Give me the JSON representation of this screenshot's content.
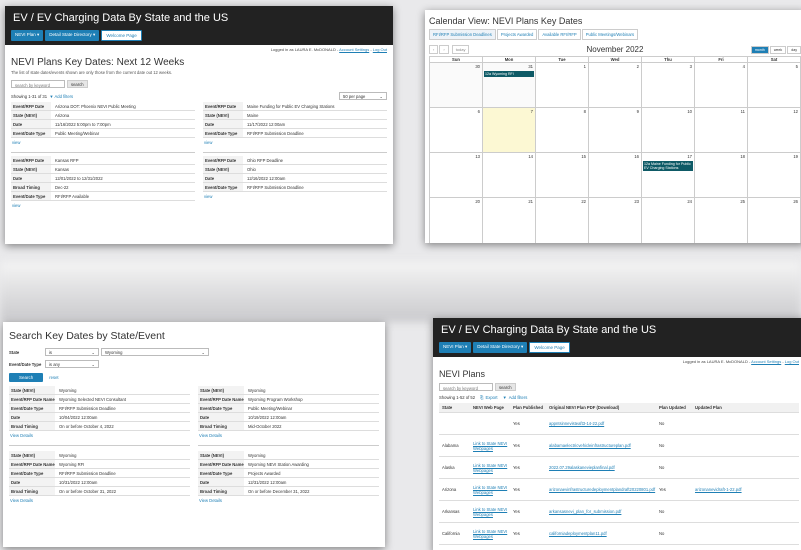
{
  "p1": {
    "app_title": "EV / EV Charging Data By State and the US",
    "nav": [
      "NEVI Plan ▾",
      "Detail State Directory ▾",
      "Welcome Page"
    ],
    "login_prefix": "Logged in as LAURA E. McDONALD - ",
    "account_settings": "Account Settings",
    "login_sep": " - ",
    "logout": "Log Out",
    "title": "NEVI Plans Key Dates: Next 12 Weeks",
    "subtitle": "The list of state dates/events shown are only those from the current date out 12 weeks.",
    "search_placeholder": "search by keyword",
    "search_btn": "search",
    "showing": "Showing 1-31 of 31",
    "add_filters": "Add filters",
    "per_page": "50 per page",
    "view_label": "view",
    "records": [
      {
        "fields": [
          [
            "Event/RFP Date",
            "Arizona DOT: Phoenix NEVI Public Meeting"
          ],
          [
            "State (NEVI)",
            "Arizona"
          ],
          [
            "Date",
            "11/16/2022 5:00pm to 7:00pm"
          ],
          [
            "Event/Date Type",
            "Public Meeting/Webinar"
          ]
        ]
      },
      {
        "fields": [
          [
            "Event/RFP Date",
            "Maine Funding for Public EV Charging Stations"
          ],
          [
            "State (NEVI)",
            "Maine"
          ],
          [
            "Date",
            "11/17/2022 12:00am"
          ],
          [
            "Event/Date Type",
            "RFI/RFP Submission Deadline"
          ]
        ]
      },
      {
        "fields": [
          [
            "Event/RFP Date",
            "Kansas RFP"
          ],
          [
            "State (NEVI)",
            "Kansas"
          ],
          [
            "Date",
            "12/01/2022 to 12/31/2022"
          ],
          [
            "Broad Timing",
            "Dec-22"
          ],
          [
            "Event/Date Type",
            "RFI/RFP Available"
          ]
        ]
      },
      {
        "fields": [
          [
            "Event/RFP Date",
            "Ohio RFP Deadline"
          ],
          [
            "State (NEVI)",
            "Ohio"
          ],
          [
            "Date",
            "12/16/2022 12:00am"
          ],
          [
            "Event/Date Type",
            "RFI/RFP Submission Deadline"
          ]
        ]
      }
    ]
  },
  "p2": {
    "title": "Calendar View: NEVI Plans Key Dates",
    "tabs": [
      "RFI/RFP Submission Deadlines",
      "Projects Awarded",
      "Available RFI/RFP",
      "Public Meetings/Webinars"
    ],
    "nav_prev": "‹",
    "nav_next": "›",
    "today": "today",
    "month": "November 2022",
    "views": [
      "month",
      "week",
      "day"
    ],
    "days": [
      "Sun",
      "Mon",
      "Tue",
      "Wed",
      "Thu",
      "Fri",
      "Sat"
    ],
    "weeks": [
      [
        "30",
        "31",
        "1",
        "2",
        "3",
        "4",
        "5"
      ],
      [
        "6",
        "7",
        "8",
        "9",
        "10",
        "11",
        "12"
      ],
      [
        "13",
        "14",
        "15",
        "16",
        "17",
        "18",
        "19"
      ],
      [
        "20",
        "21",
        "22",
        "23",
        "24",
        "25",
        "26"
      ]
    ],
    "event1": "12a Wyoming RFI",
    "event2": "12a Maine Funding for Public EV Charging Stations"
  },
  "p3": {
    "title": "Search Key Dates by State/Event",
    "state_label": "State",
    "op": "is",
    "state_value": "Wyoming",
    "type_label": "Event/Date Type",
    "type_value": "is any",
    "search_btn": "Search",
    "reset": "reset",
    "view_details": "View Details",
    "records": [
      {
        "fields": [
          [
            "State (NEVI)",
            "Wyoming"
          ],
          [
            "Event/RFP Date Name",
            "Wyoming Selected NEVI Consultant"
          ],
          [
            "Event/Date Type",
            "RFI/RFP Submission Deadline"
          ],
          [
            "Date",
            "10/04/2022 12:00am"
          ],
          [
            "Broad Timing",
            "On or before October 4, 2022"
          ]
        ]
      },
      {
        "fields": [
          [
            "State (NEVI)",
            "Wyoming"
          ],
          [
            "Event/RFP Date Name",
            "Wyoming Program Workshop"
          ],
          [
            "Event/Date Type",
            "Public Meeting/Webinar"
          ],
          [
            "Date",
            "10/19/2022 12:00am"
          ],
          [
            "Broad Timing",
            "Mid-October 2022"
          ]
        ]
      },
      {
        "fields": [
          [
            "State (NEVI)",
            "Wyoming"
          ],
          [
            "Event/RFP Date Name",
            "Wyoming RFI"
          ],
          [
            "Event/Date Type",
            "RFI/RFP Submission Deadline"
          ],
          [
            "Date",
            "10/31/2022 12:00am"
          ],
          [
            "Broad Timing",
            "On or before October 31, 2022"
          ]
        ]
      },
      {
        "fields": [
          [
            "State (NEVI)",
            "Wyoming"
          ],
          [
            "Event/RFP Date Name",
            "Wyoming NEVI Station Awarding"
          ],
          [
            "Event/Date Type",
            "Projects Awarded"
          ],
          [
            "Date",
            "12/31/2022 12:00am"
          ],
          [
            "Broad Timing",
            "On or before December 31, 2022"
          ]
        ]
      }
    ]
  },
  "p4": {
    "app_title": "EV / EV Charging Data By State and the US",
    "nav": [
      "NEVI Plan ▾",
      "Detail State Directory ▾",
      "Welcome Page"
    ],
    "login_prefix": "Logged in as LAURA E. McDONALD - ",
    "account_settings": "Account Settings",
    "login_sep": " - ",
    "logout": "Log Out",
    "title": "NEVI Plans",
    "search_placeholder": "search by keyword",
    "search_btn": "search",
    "showing": "Showing 1-52 of 52",
    "export": "Export",
    "add_filters": "Add filters",
    "columns": [
      "State",
      "NEVI Web Page",
      "Plan Published",
      "Original NEVI Plan PDF (Download)",
      "Plan Updated",
      "Updated Plan"
    ],
    "rows": [
      {
        "state": "",
        "web": "",
        "pub": "Yes",
        "pdf": "appntsinnevisteaft3-14-22.pdf",
        "upd": "No",
        "updplan": ""
      },
      {
        "state": "Alabama",
        "web": "Link to State NEVI Webpages",
        "pub": "Yes",
        "pdf": "alabamaelectricvehicleinfrastructureplan.pdf",
        "upd": "No",
        "updplan": ""
      },
      {
        "state": "Alaska",
        "web": "Link to State NEVI Webpages",
        "pub": "Yes",
        "pdf": "2022.07.29alaskanevieplanfinal.pdf",
        "upd": "No",
        "updplan": ""
      },
      {
        "state": "Arizona",
        "web": "Link to State NEVI Webpages",
        "pub": "Yes",
        "pdf": "arizonaevinfrastructuredeploymentplandraft20220801.pdf",
        "upd": "Yes",
        "updplan": "arizonanevidraft-1-22.pdf"
      },
      {
        "state": "Arkansas",
        "web": "Link to State NEVI Webpages",
        "pub": "Yes",
        "pdf": "arkansasnevi_plan_for_submission.pdf",
        "upd": "No",
        "updplan": ""
      },
      {
        "state": "California",
        "web": "Link to State NEVI Webpages",
        "pub": "Yes",
        "pdf": "californiadeploymentplan11.pdf",
        "upd": "No",
        "updplan": ""
      }
    ]
  }
}
